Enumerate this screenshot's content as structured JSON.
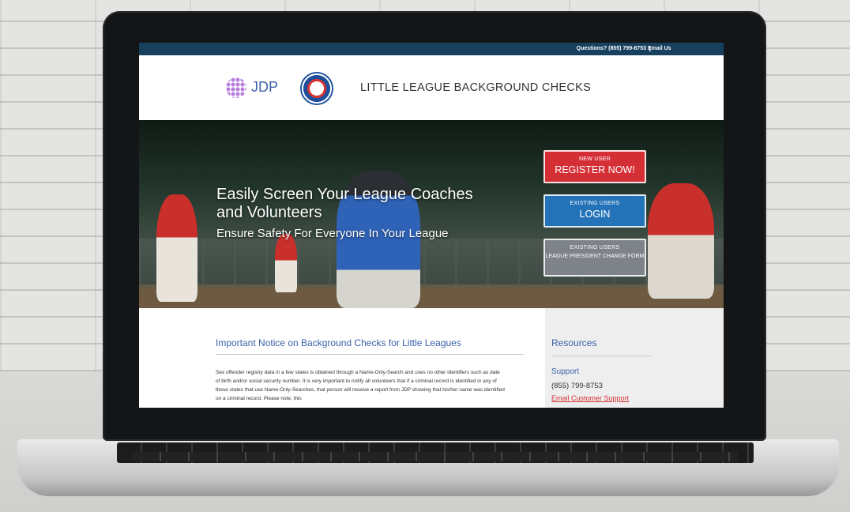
{
  "topbar": {
    "contact": "Questions? (855) 799-8753",
    "separator": "|",
    "email": "Email Us"
  },
  "header": {
    "jdp_logo_text": "JDP",
    "site_title": "LITTLE LEAGUE BACKGROUND CHECKS"
  },
  "hero": {
    "heading": "Easily Screen Your League Coaches and Volunteers",
    "subheading": "Ensure Safety For Everyone In Your League",
    "buttons": {
      "new_user_small": "NEW USER",
      "new_user_big": "REGISTER NOW!",
      "login_small": "EXISTING USERS",
      "login_big": "LOGIN",
      "change_small": "EXISTING USERS",
      "change_big": "LEAGUE PRESIDENT CHANGE FORM"
    }
  },
  "notice": {
    "title": "Important Notice on Background Checks for Little Leagues",
    "body": "Sex offender registry data in a few states is obtained through a Name-Only-Search and uses no other identifiers such as date of birth and/or social security number. It is very important to notify all volunteers that if a criminal record is identified in any of these states that use Name-Only-Searches, that person will receive a report from JDP showing that his/her name was identified on a criminal record. Please note, this"
  },
  "resources": {
    "title": "Resources",
    "support_title": "Support",
    "phone": "(855) 799-8753",
    "email_link": "Email Customer Support"
  },
  "colors": {
    "topbar": "#17405f",
    "accent_blue": "#3a5fa8",
    "register_red": "#d52f36",
    "login_blue": "#2472b8",
    "change_gray": "#7d8388"
  }
}
